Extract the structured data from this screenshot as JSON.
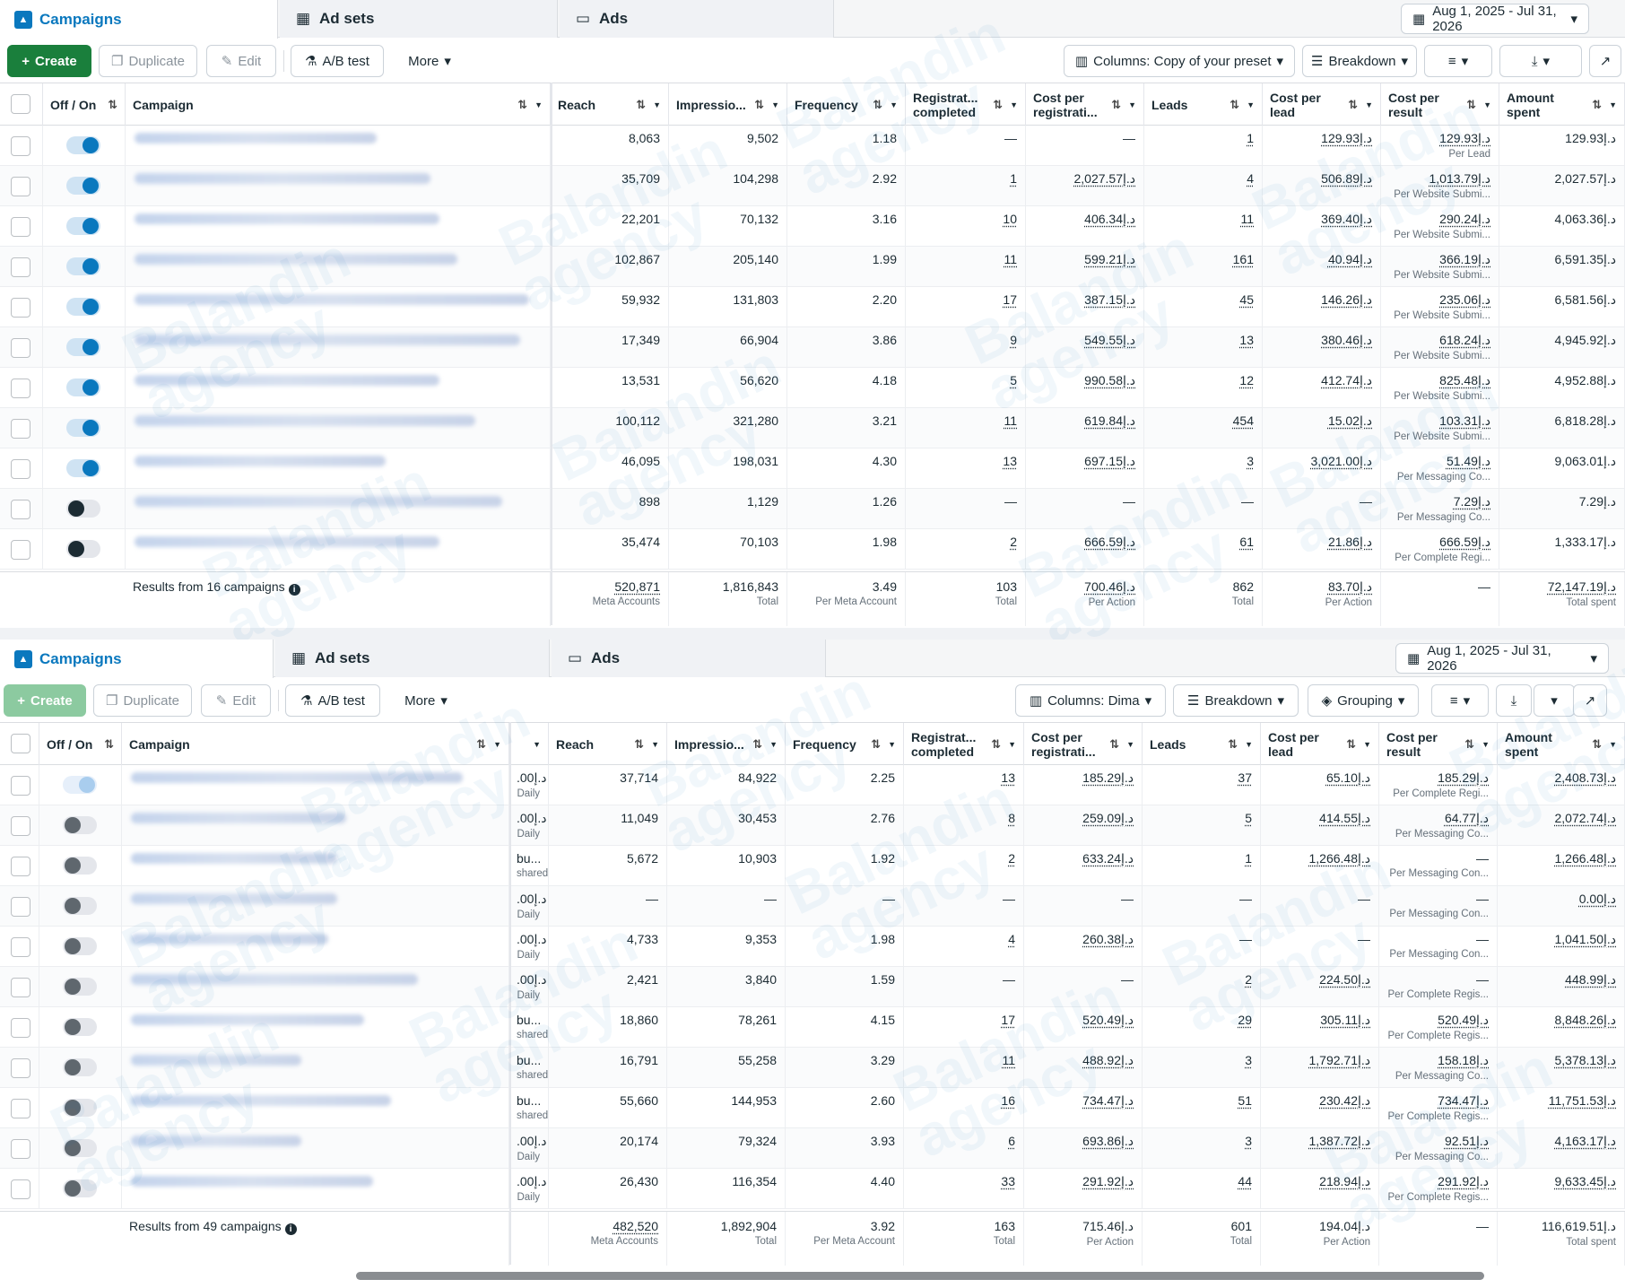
{
  "colors": {
    "accent": "#0a78be",
    "create": "#1a7f3c"
  },
  "watermark": {
    "line1": "Balandin",
    "line2": "agency"
  },
  "panels": [
    {
      "tabs": {
        "campaigns": "Campaigns",
        "adsets": "Ad sets",
        "ads": "Ads"
      },
      "date_range": "Aug 1, 2025 - Jul 31, 2026",
      "toolbar": {
        "create": "Create",
        "duplicate": "Duplicate",
        "edit": "Edit",
        "ab_test": "A/B test",
        "more": "More",
        "columns": "Columns: Copy of your preset",
        "breakdown": "Breakdown",
        "grouping": ""
      },
      "headers": {
        "offon": "Off / On",
        "campaign": "Campaign",
        "budget": "",
        "reach": "Reach",
        "impressions": "Impressio...",
        "frequency": "Frequency",
        "reg": "Registrat... completed",
        "cpr": "Cost per registrati...",
        "leads": "Leads",
        "cpl": "Cost per lead",
        "cpres": "Cost per result",
        "spent": "Amount spent"
      },
      "rows": [
        {
          "toggle": "on",
          "budget": "",
          "budget_sub": "",
          "reach": "8,063",
          "impressions": "9,502",
          "frequency": "1.18",
          "reg": "—",
          "cpr": "—",
          "leads": "1",
          "cpl": "129.93د.إ",
          "cpres": "129.93د.إ",
          "cpres_sub": "Per Lead",
          "spent": "129.93د.إ"
        },
        {
          "toggle": "on",
          "budget": "",
          "budget_sub": "",
          "reach": "35,709",
          "impressions": "104,298",
          "frequency": "2.92",
          "reg": "1",
          "cpr": "2,027.57د.إ",
          "leads": "4",
          "cpl": "506.89د.إ",
          "cpres": "1,013.79د.إ",
          "cpres_sub": "Per Website Submi...",
          "spent": "2,027.57د.إ"
        },
        {
          "toggle": "on",
          "budget": "",
          "budget_sub": "",
          "reach": "22,201",
          "impressions": "70,132",
          "frequency": "3.16",
          "reg": "10",
          "cpr": "406.34د.إ",
          "leads": "11",
          "cpl": "369.40د.إ",
          "cpres": "290.24د.إ",
          "cpres_sub": "Per Website Submi...",
          "spent": "4,063.36د.إ"
        },
        {
          "toggle": "on",
          "budget": "",
          "budget_sub": "",
          "reach": "102,867",
          "impressions": "205,140",
          "frequency": "1.99",
          "reg": "11",
          "cpr": "599.21د.إ",
          "leads": "161",
          "cpl": "40.94د.إ",
          "cpres": "366.19د.إ",
          "cpres_sub": "Per Website Submi...",
          "spent": "6,591.35د.إ"
        },
        {
          "toggle": "on",
          "budget": "",
          "budget_sub": "",
          "reach": "59,932",
          "impressions": "131,803",
          "frequency": "2.20",
          "reg": "17",
          "cpr": "387.15د.إ",
          "leads": "45",
          "cpl": "146.26د.إ",
          "cpres": "235.06د.إ",
          "cpres_sub": "Per Website Submi...",
          "spent": "6,581.56د.إ"
        },
        {
          "toggle": "on",
          "budget": "",
          "budget_sub": "",
          "reach": "17,349",
          "impressions": "66,904",
          "frequency": "3.86",
          "reg": "9",
          "cpr": "549.55د.إ",
          "leads": "13",
          "cpl": "380.46د.إ",
          "cpres": "618.24د.إ",
          "cpres_sub": "Per Website Submi...",
          "spent": "4,945.92د.إ"
        },
        {
          "toggle": "on",
          "budget": "",
          "budget_sub": "",
          "reach": "13,531",
          "impressions": "56,620",
          "frequency": "4.18",
          "reg": "5",
          "cpr": "990.58د.إ",
          "leads": "12",
          "cpl": "412.74د.إ",
          "cpres": "825.48د.إ",
          "cpres_sub": "Per Website Submi...",
          "spent": "4,952.88د.إ"
        },
        {
          "toggle": "on",
          "budget": "",
          "budget_sub": "",
          "reach": "100,112",
          "impressions": "321,280",
          "frequency": "3.21",
          "reg": "11",
          "cpr": "619.84د.إ",
          "leads": "454",
          "cpl": "15.02د.إ",
          "cpres": "103.31د.إ",
          "cpres_sub": "Per Website Submi...",
          "spent": "6,818.28د.إ"
        },
        {
          "toggle": "on",
          "budget": "",
          "budget_sub": "",
          "reach": "46,095",
          "impressions": "198,031",
          "frequency": "4.30",
          "reg": "13",
          "cpr": "697.15د.إ",
          "leads": "3",
          "cpl": "3,021.00د.إ",
          "cpres": "51.49د.إ",
          "cpres_sub": "Per Messaging Co...",
          "spent": "9,063.01د.إ"
        },
        {
          "toggle": "off",
          "budget": "",
          "budget_sub": "",
          "reach": "898",
          "impressions": "1,129",
          "frequency": "1.26",
          "reg": "—",
          "cpr": "—",
          "leads": "—",
          "cpl": "—",
          "cpres": "7.29د.إ",
          "cpres_sub": "Per Messaging Co...",
          "spent": "7.29د.إ"
        },
        {
          "toggle": "off",
          "budget": "",
          "budget_sub": "",
          "reach": "35,474",
          "impressions": "70,103",
          "frequency": "1.98",
          "reg": "2",
          "cpr": "666.59د.إ",
          "leads": "61",
          "cpl": "21.86د.إ",
          "cpres": "666.59د.إ",
          "cpres_sub": "Per Complete Regi...",
          "spent": "1,333.17د.إ"
        }
      ],
      "totals": {
        "label": "Results from 16 campaigns",
        "budget": "",
        "budget_sub": "",
        "reach": "520,871",
        "reach_sub": "Meta Accounts",
        "impressions": "1,816,843",
        "impressions_sub": "Total",
        "frequency": "3.49",
        "frequency_sub": "Per Meta Account",
        "reg": "103",
        "reg_sub": "Total",
        "cpr": "700.46د.إ",
        "cpr_sub": "Per Action",
        "leads": "862",
        "leads_sub": "Total",
        "cpl": "83.70د.إ",
        "cpl_sub": "Per Action",
        "cpres": "—",
        "cpres_sub": "",
        "spent": "72,147.19د.إ",
        "spent_sub": "Total spent"
      }
    },
    {
      "tabs": {
        "campaigns": "Campaigns",
        "adsets": "Ad sets",
        "ads": "Ads"
      },
      "date_range": "Aug 1, 2025 - Jul 31, 2026",
      "toolbar": {
        "create": "Create",
        "duplicate": "Duplicate",
        "edit": "Edit",
        "ab_test": "A/B test",
        "more": "More",
        "columns": "Columns: Dima",
        "breakdown": "Breakdown",
        "grouping": "Grouping"
      },
      "headers": {
        "offon": "Off / On",
        "campaign": "Campaign",
        "budget": "",
        "reach": "Reach",
        "impressions": "Impressio...",
        "frequency": "Frequency",
        "reg": "Registrat... completed",
        "cpr": "Cost per registrati...",
        "leads": "Leads",
        "cpl": "Cost per lead",
        "cpres": "Cost per result",
        "spent": "Amount spent"
      },
      "rows": [
        {
          "toggle": "light",
          "budget": ".00د.إ",
          "budget_sub": "Daily",
          "reach": "37,714",
          "impressions": "84,922",
          "frequency": "2.25",
          "reg": "13",
          "cpr": "185.29د.إ",
          "leads": "37",
          "cpl": "65.10د.إ",
          "cpres": "185.29د.إ",
          "cpres_sub": "Per Complete Regi...",
          "spent": "2,408.73د.إ"
        },
        {
          "toggle": "off2",
          "budget": ".00د.إ",
          "budget_sub": "Daily",
          "reach": "11,049",
          "impressions": "30,453",
          "frequency": "2.76",
          "reg": "8",
          "cpr": "259.09د.إ",
          "leads": "5",
          "cpl": "414.55د.إ",
          "cpres": "64.77د.إ",
          "cpres_sub": "Per Messaging Co...",
          "spent": "2,072.74د.إ"
        },
        {
          "toggle": "off2",
          "budget": "bu...",
          "budget_sub": "shared",
          "reach": "5,672",
          "impressions": "10,903",
          "frequency": "1.92",
          "reg": "2",
          "cpr": "633.24د.إ",
          "leads": "1",
          "cpl": "1,266.48د.إ",
          "cpres": "—",
          "cpres_sub": "Per Messaging Con...",
          "spent": "1,266.48د.إ"
        },
        {
          "toggle": "off2",
          "budget": ".00د.إ",
          "budget_sub": "Daily",
          "reach": "—",
          "impressions": "—",
          "frequency": "—",
          "reg": "—",
          "cpr": "—",
          "leads": "—",
          "cpl": "—",
          "cpres": "—",
          "cpres_sub": "Per Messaging Con...",
          "spent": "0.00د.إ"
        },
        {
          "toggle": "off2",
          "budget": ".00د.إ",
          "budget_sub": "Daily",
          "reach": "4,733",
          "impressions": "9,353",
          "frequency": "1.98",
          "reg": "4",
          "cpr": "260.38د.إ",
          "leads": "—",
          "cpl": "—",
          "cpres": "—",
          "cpres_sub": "Per Messaging Con...",
          "spent": "1,041.50د.إ"
        },
        {
          "toggle": "off2",
          "budget": ".00د.إ",
          "budget_sub": "Daily",
          "reach": "2,421",
          "impressions": "3,840",
          "frequency": "1.59",
          "reg": "—",
          "cpr": "—",
          "leads": "2",
          "cpl": "224.50د.إ",
          "cpres": "—",
          "cpres_sub": "Per Complete Regis...",
          "spent": "448.99د.إ"
        },
        {
          "toggle": "off2",
          "budget": "bu...",
          "budget_sub": "shared",
          "reach": "18,860",
          "impressions": "78,261",
          "frequency": "4.15",
          "reg": "17",
          "cpr": "520.49د.إ",
          "leads": "29",
          "cpl": "305.11د.إ",
          "cpres": "520.49د.إ",
          "cpres_sub": "Per Complete Regis...",
          "spent": "8,848.26د.إ"
        },
        {
          "toggle": "off2",
          "budget": "bu...",
          "budget_sub": "shared",
          "reach": "16,791",
          "impressions": "55,258",
          "frequency": "3.29",
          "reg": "11",
          "cpr": "488.92د.إ",
          "leads": "3",
          "cpl": "1,792.71د.إ",
          "cpres": "158.18د.إ",
          "cpres_sub": "Per Messaging Co...",
          "spent": "5,378.13د.إ"
        },
        {
          "toggle": "off2",
          "budget": "bu...",
          "budget_sub": "shared",
          "reach": "55,660",
          "impressions": "144,953",
          "frequency": "2.60",
          "reg": "16",
          "cpr": "734.47د.إ",
          "leads": "51",
          "cpl": "230.42د.إ",
          "cpres": "734.47د.إ",
          "cpres_sub": "Per Complete Regis...",
          "spent": "11,751.53د.إ"
        },
        {
          "toggle": "off2",
          "budget": ".00د.إ",
          "budget_sub": "Daily",
          "reach": "20,174",
          "impressions": "79,324",
          "frequency": "3.93",
          "reg": "6",
          "cpr": "693.86د.إ",
          "leads": "3",
          "cpl": "1,387.72د.إ",
          "cpres": "92.51د.إ",
          "cpres_sub": "Per Messaging Co...",
          "spent": "4,163.17د.إ"
        },
        {
          "toggle": "off2",
          "budget": ".00د.إ",
          "budget_sub": "Daily",
          "reach": "26,430",
          "impressions": "116,354",
          "frequency": "4.40",
          "reg": "33",
          "cpr": "291.92د.إ",
          "leads": "44",
          "cpl": "218.94د.إ",
          "cpres": "291.92د.إ",
          "cpres_sub": "Per Complete Regis...",
          "spent": "9,633.45د.إ"
        }
      ],
      "totals": {
        "label": "Results from 49 campaigns",
        "budget": "",
        "budget_sub": "",
        "reach": "482,520",
        "reach_sub": "Meta Accounts",
        "impressions": "1,892,904",
        "impressions_sub": "Total",
        "frequency": "3.92",
        "frequency_sub": "Per Meta Account",
        "reg": "163",
        "reg_sub": "Total",
        "cpr": "715.46د.إ",
        "cpr_sub": "Per Action",
        "leads": "601",
        "leads_sub": "Total",
        "cpl": "194.04د.إ",
        "cpl_sub": "Per Action",
        "cpres": "—",
        "cpres_sub": "",
        "spent": "116,619.51د.إ",
        "spent_sub": "Total spent"
      }
    }
  ]
}
